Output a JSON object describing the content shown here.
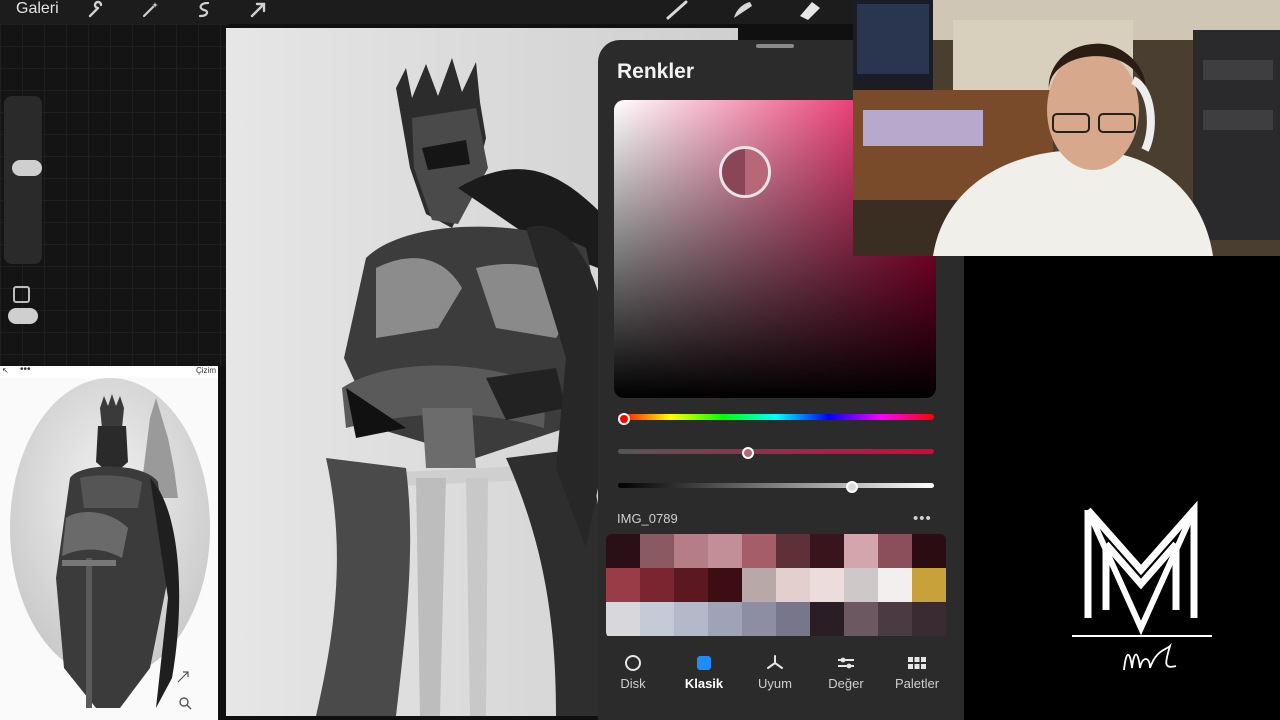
{
  "toolbar": {
    "gallery_label": "Galeri",
    "icons": [
      "wrench-icon",
      "magic-wand-icon",
      "selection-icon",
      "transform-arrow-icon",
      "brush-icon",
      "smudge-icon",
      "eraser-icon"
    ]
  },
  "reference": {
    "title_fragment": "Çizim"
  },
  "color_panel": {
    "title": "Renkler",
    "palette_name": "IMG_0789",
    "more_label": "•••",
    "current_color": "#b76878",
    "previous_color": "#8a4656",
    "hue_level": 0.0,
    "saturation_level": 0.41,
    "brightness_level": 0.74,
    "swatches": [
      "#2b0f17",
      "#8a5a63",
      "#b57d86",
      "#c28f98",
      "#a65d6a",
      "#5e3038",
      "#3a141c",
      "#d3a6ae",
      "#8b4f5a",
      "#2a0c12",
      "#9a3b48",
      "#7a2530",
      "#5c1820",
      "#3d0d14",
      "#b9a8a8",
      "#e4cfcf",
      "#ecdcdc",
      "#cfc8c8",
      "#f2f0ee",
      "#c8a13a",
      "#d8d8dc",
      "#c6c9d6",
      "#b4b8c9",
      "#a0a3b6",
      "#8d8ea3",
      "#77768a",
      "#2b1d24",
      "#6b5860",
      "#4a3b42",
      "#3a2b32"
    ],
    "tabs": [
      {
        "label": "Disk",
        "icon": "disc-icon"
      },
      {
        "label": "Klasik",
        "icon": "square-icon"
      },
      {
        "label": "Uyum",
        "icon": "harmony-icon"
      },
      {
        "label": "Değer",
        "icon": "sliders-icon"
      },
      {
        "label": "Paletler",
        "icon": "grid-icon"
      }
    ],
    "active_tab": "Klasik"
  },
  "colors": {
    "accent": "#1e8cff",
    "panel_bg": "#2b2b2b",
    "ring_gold": "#c8a13a"
  }
}
